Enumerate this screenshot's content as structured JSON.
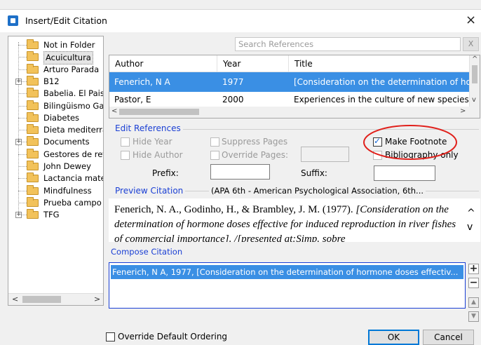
{
  "window": {
    "title": "Insert/Edit Citation",
    "close_glyph": "×"
  },
  "folders": [
    {
      "label": "Not in Folder",
      "expandable": false,
      "selected": false
    },
    {
      "label": "Acuicultura",
      "expandable": false,
      "selected": true
    },
    {
      "label": "Arturo Parada",
      "expandable": false,
      "selected": false
    },
    {
      "label": "B12",
      "expandable": true,
      "selected": false
    },
    {
      "label": "Babelia. El Pais",
      "expandable": false,
      "selected": false
    },
    {
      "label": "Bilingüismo Ga",
      "expandable": false,
      "selected": false
    },
    {
      "label": "Diabetes",
      "expandable": false,
      "selected": false
    },
    {
      "label": "Dieta mediterra",
      "expandable": false,
      "selected": false
    },
    {
      "label": "Documents",
      "expandable": true,
      "selected": false
    },
    {
      "label": "Gestores de ref",
      "expandable": false,
      "selected": false
    },
    {
      "label": "John Dewey",
      "expandable": false,
      "selected": false
    },
    {
      "label": "Lactancia mate",
      "expandable": false,
      "selected": false
    },
    {
      "label": "Mindfulness",
      "expandable": false,
      "selected": false
    },
    {
      "label": "Prueba campo",
      "expandable": false,
      "selected": false
    },
    {
      "label": "TFG",
      "expandable": true,
      "selected": false
    }
  ],
  "search": {
    "placeholder": "Search References",
    "clear_label": "X"
  },
  "references": {
    "columns": [
      "Author",
      "Year",
      "Title"
    ],
    "rows": [
      {
        "author": "Fenerich, N A",
        "year": "1977",
        "title": "[Consideration on the determination of horm",
        "selected": true
      },
      {
        "author": "Pastor, E",
        "year": "2000",
        "title": "Experiences in the culture of new species in t",
        "selected": false
      }
    ]
  },
  "edit_references": {
    "title": "Edit References",
    "hide_year": "Hide Year",
    "hide_author": "Hide Author",
    "suppress_pages": "Suppress Pages",
    "override_pages": "Override Pages:",
    "make_footnote": "Make Footnote",
    "make_footnote_checked": true,
    "bibliography_only": "Bibliography only",
    "prefix_label": "Prefix:",
    "suffix_label": "Suffix:"
  },
  "preview": {
    "title": "Preview Citation",
    "style": "(APA 6th - American Psychological Association, 6th...",
    "text_plain": "Fenerich, N. A., Godinho, H., & Brambley, J. M. (1977). ",
    "text_italic": "[Consideration on the determination of hormone doses effective for induced reproduction in river fishes of commercial importance]. /[presented at:Simp. sobre"
  },
  "compose": {
    "title": "Compose Citation",
    "item": "Fenerich, N A, 1977, [Consideration on the determination of hormone doses effectiv..."
  },
  "side_buttons": {
    "add": "+",
    "remove": "−"
  },
  "footer": {
    "override_ordering": "Override Default Ordering",
    "ok": "OK",
    "cancel": "Cancel"
  },
  "colors": {
    "accent": "#3a8fe4",
    "group_title": "#1a3fd4",
    "annotation": "#e0201b"
  },
  "icons": {
    "app": "citation-app-icon",
    "folder": "folder-icon",
    "expand": "plus-expander-icon"
  }
}
